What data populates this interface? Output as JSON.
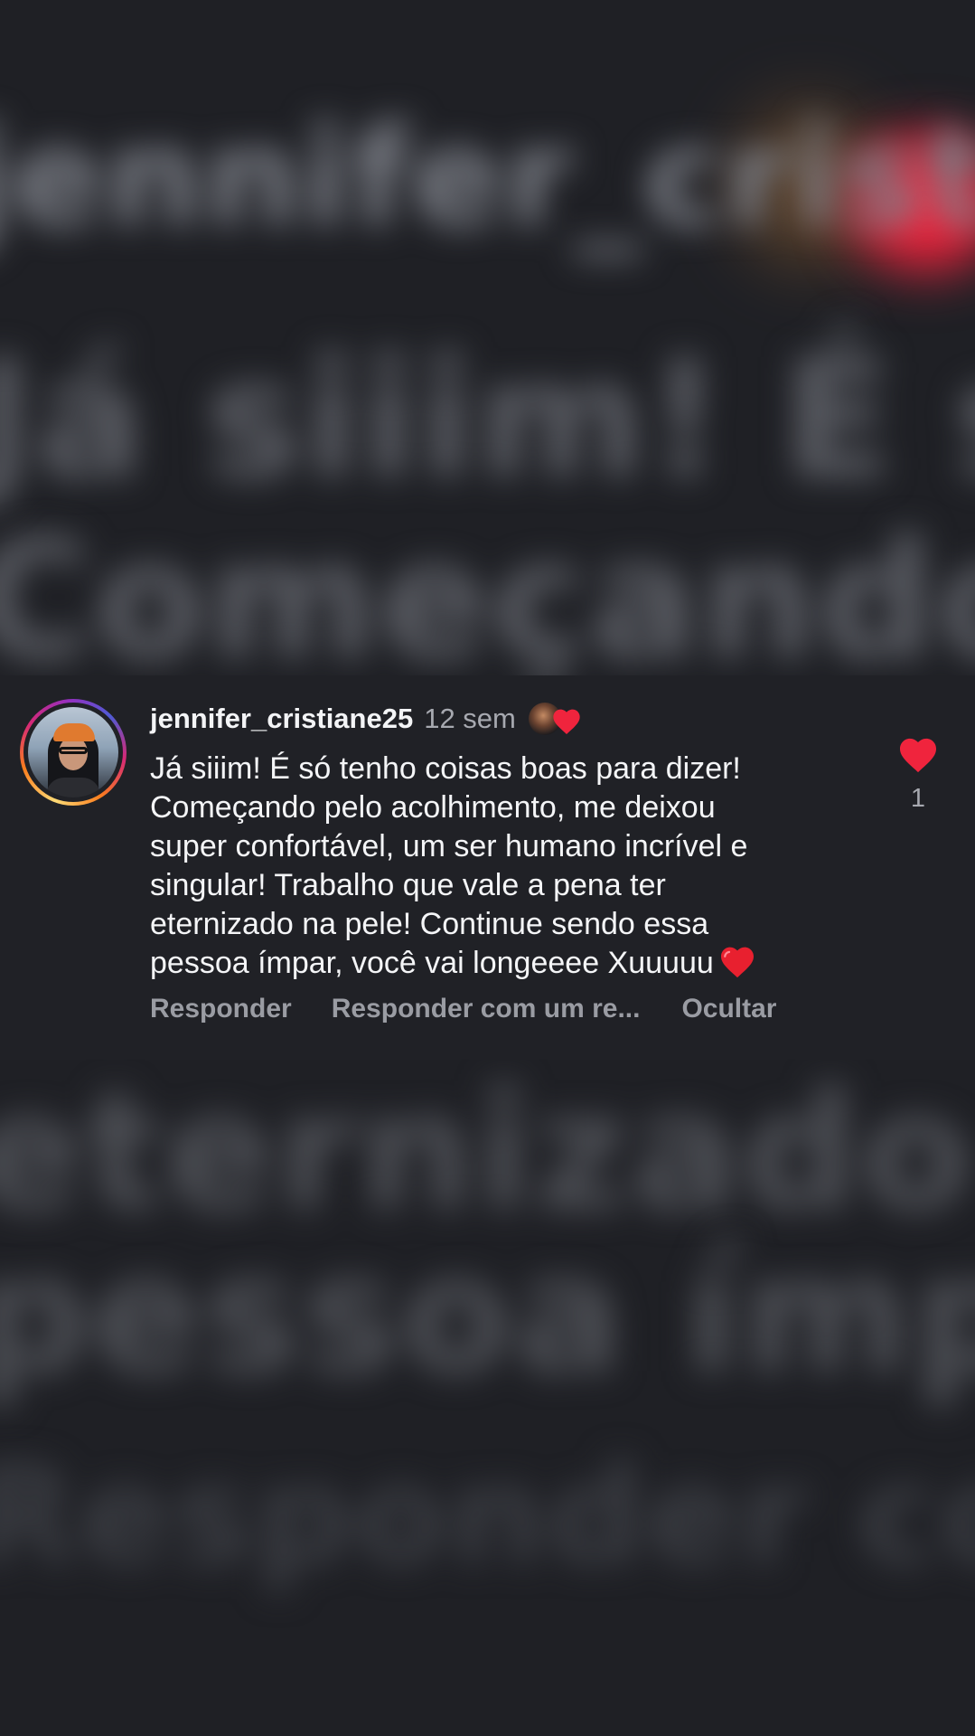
{
  "comment": {
    "username": "jennifer_cristiane25",
    "time_ago": "12 sem",
    "text_lines": [
      "Já siiim! É só tenho coisas boas para dizer!",
      "Começando pelo acolhimento, me deixou",
      "super confortável, um ser humano incrível e",
      "singular! Trabalho que vale a pena ter",
      "eternizado na pele! Continue sendo essa",
      "pessoa ímpar, você vai longeeee Xuuuuu"
    ],
    "like_count": "1",
    "liked_by_creator": true
  },
  "actions": {
    "reply": "Responder",
    "reply_with_sticker": "Responder com um re...",
    "hide": "Ocultar"
  },
  "icons": {
    "like": "heart-icon",
    "inline_emoji": "red-heart-emoji",
    "creator_like": "creator-heart-badge"
  },
  "colors": {
    "heart": "#f0243d",
    "background": "#1f2025",
    "card": "#202126",
    "text": "#f4f5f7",
    "muted": "#a7a9b0"
  }
}
